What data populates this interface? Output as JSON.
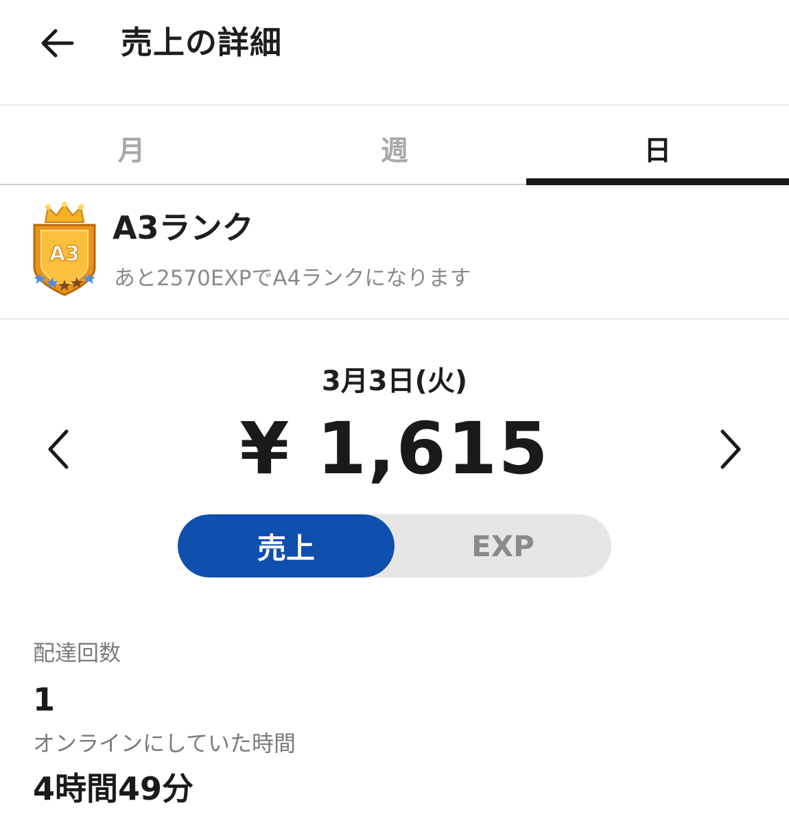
{
  "header": {
    "title": "売上の詳細",
    "back_icon": "arrow-left-icon"
  },
  "tabs": [
    {
      "label": "月",
      "active": false
    },
    {
      "label": "週",
      "active": false
    },
    {
      "label": "日",
      "active": true
    }
  ],
  "rank": {
    "badge_text": "A3",
    "badge_icon": "rank-badge-icon",
    "title": "A3ランク",
    "subtitle": "あと2570EXPでA4ランクになります"
  },
  "summary": {
    "date": "3月3日(火)",
    "amount": "¥ 1,615",
    "prev_icon": "chevron-left-icon",
    "next_icon": "chevron-right-icon"
  },
  "toggle": {
    "options": [
      {
        "label": "売上",
        "active": true
      },
      {
        "label": "EXP",
        "active": false
      }
    ],
    "active_color": "#0f4fae"
  },
  "stats": [
    {
      "label": "配達回数",
      "value": "1"
    },
    {
      "label": "オンラインにしていた時間",
      "value": "4時間49分"
    }
  ]
}
